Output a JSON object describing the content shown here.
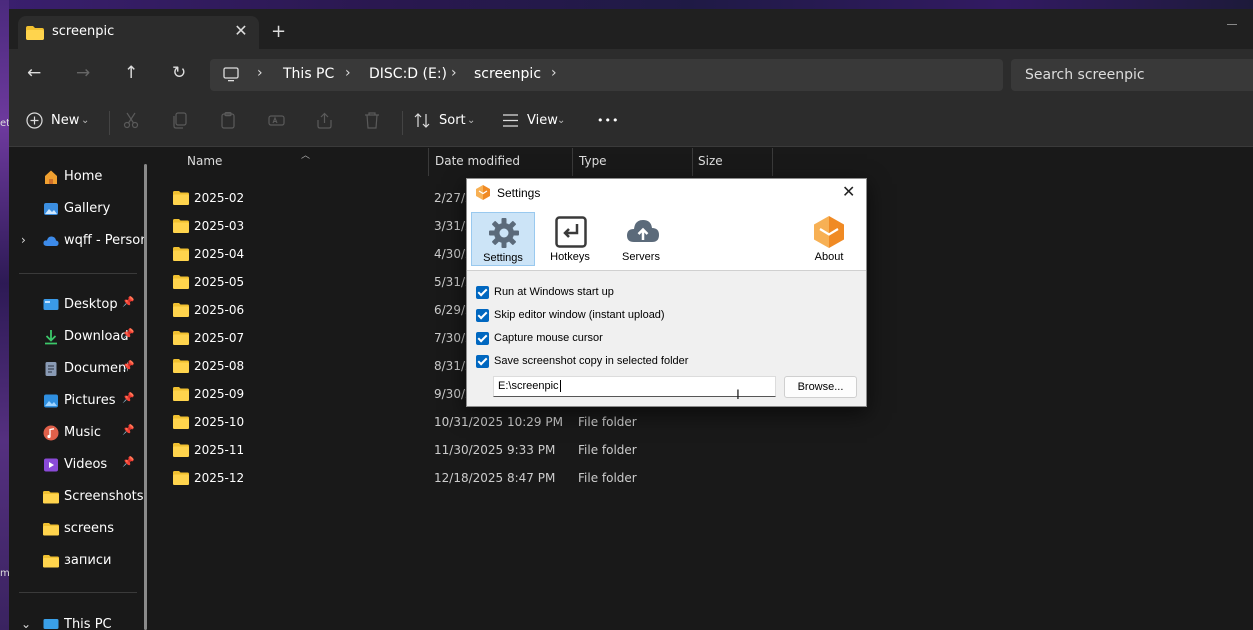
{
  "desktop": {
    "left_text_1": "et",
    "left_text_2": "m"
  },
  "tab": {
    "title": "screenpic",
    "close": "✕",
    "new_tab": "+"
  },
  "nav": {
    "back": "←",
    "forward": "→",
    "up": "↑",
    "refresh": "↻"
  },
  "breadcrumb": [
    "This PC",
    "DISC:D (E:)",
    "screenpic"
  ],
  "search": {
    "placeholder": "Search screenpic"
  },
  "commands": {
    "new": "New",
    "sort": "Sort",
    "view": "View",
    "more": "•••"
  },
  "sidebar": {
    "items": [
      {
        "label": "Home",
        "icon": "home-icon"
      },
      {
        "label": "Gallery",
        "icon": "gallery-icon"
      },
      {
        "label": "wqff - Person",
        "icon": "cloud-icon"
      },
      {
        "label": "Desktop",
        "icon": "desktop-icon",
        "pinned": true
      },
      {
        "label": "Download:",
        "icon": "download-icon",
        "pinned": true
      },
      {
        "label": "Document",
        "icon": "document-icon",
        "pinned": true
      },
      {
        "label": "Pictures",
        "icon": "pictures-icon",
        "pinned": true
      },
      {
        "label": "Music",
        "icon": "music-icon",
        "pinned": true
      },
      {
        "label": "Videos",
        "icon": "videos-icon",
        "pinned": true
      },
      {
        "label": "Screenshots",
        "icon": "folder-icon"
      },
      {
        "label": "screens",
        "icon": "folder-icon"
      },
      {
        "label": "записи",
        "icon": "folder-icon"
      },
      {
        "label": "This PC",
        "icon": "pc-icon"
      }
    ],
    "pin_glyph": "📌"
  },
  "columns": {
    "name": "Name",
    "date": "Date modified",
    "type": "Type",
    "size": "Size"
  },
  "files": [
    {
      "name": "2025-02",
      "date": "2/27/2",
      "type": ""
    },
    {
      "name": "2025-03",
      "date": "3/31/2",
      "type": ""
    },
    {
      "name": "2025-04",
      "date": "4/30/2",
      "type": ""
    },
    {
      "name": "2025-05",
      "date": "5/31/2",
      "type": ""
    },
    {
      "name": "2025-06",
      "date": "6/29/2",
      "type": ""
    },
    {
      "name": "2025-07",
      "date": "7/30/2",
      "type": ""
    },
    {
      "name": "2025-08",
      "date": "8/31/2",
      "type": ""
    },
    {
      "name": "2025-09",
      "date": "9/30/2",
      "type": ""
    },
    {
      "name": "2025-10",
      "date": "10/31/2025 10:29 PM",
      "type": "File folder"
    },
    {
      "name": "2025-11",
      "date": "11/30/2025 9:33 PM",
      "type": "File folder"
    },
    {
      "name": "2025-12",
      "date": "12/18/2025 8:47 PM",
      "type": "File folder"
    }
  ],
  "settings_dialog": {
    "title": "Settings",
    "close": "✕",
    "tools": [
      {
        "label": "Settings",
        "icon": "gear-icon",
        "active": true
      },
      {
        "label": "Hotkeys",
        "icon": "hotkey-icon"
      },
      {
        "label": "Servers",
        "icon": "cloud-upload-icon"
      },
      {
        "label": "About",
        "icon": "app-logo-icon"
      }
    ],
    "options": [
      {
        "label": "Run at Windows start up",
        "checked": true
      },
      {
        "label": "Skip editor window (instant upload)",
        "checked": true
      },
      {
        "label": "Capture mouse cursor",
        "checked": true
      },
      {
        "label": "Save screenshot copy in selected folder",
        "checked": true
      }
    ],
    "folder_path": "E:\\screenpic",
    "browse_label": "Browse..."
  },
  "colors": {
    "accent": "#0067c0",
    "folder": "#f0c030",
    "app_orange": "#f08a24"
  }
}
